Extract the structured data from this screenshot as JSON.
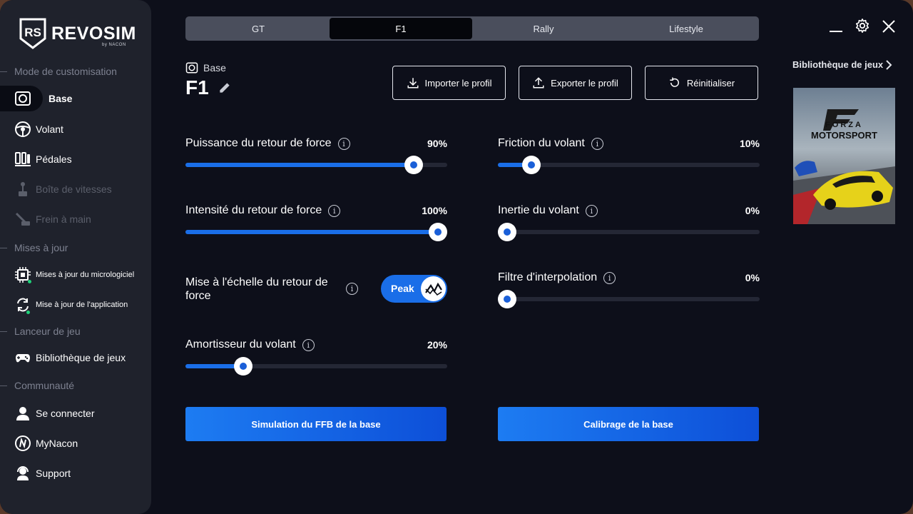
{
  "brand": {
    "name": "REVOSIM",
    "sub": "by NACON"
  },
  "sidebar": {
    "sections": {
      "customisation": "Mode de customisation",
      "updates": "Mises à jour",
      "launcher": "Lanceur de jeu",
      "community": "Communauté"
    },
    "items": {
      "base": "Base",
      "wheel": "Volant",
      "pedals": "Pédales",
      "gearbox": "Boîte de vitesses",
      "handbrake": "Frein à main",
      "firmware": "Mises à jour du micrologiciel",
      "app_update": "Mise à jour de l'application",
      "library": "Bibliothèque de jeux",
      "login": "Se connecter",
      "mynacon": "MyNacon",
      "support": "Support"
    }
  },
  "tabs": [
    "GT",
    "F1",
    "Rally",
    "Lifestyle"
  ],
  "active_tab": "F1",
  "header": {
    "device_label": "Base",
    "profile_name": "F1",
    "import_label": "Importer le profil",
    "export_label": "Exporter le profil",
    "reset_label": "Réinitialiser"
  },
  "settings": {
    "ffb_power": {
      "label": "Puissance du retour de force",
      "value_text": "90%",
      "value": 0.9
    },
    "ffb_intensity": {
      "label": "Intensité du retour de force",
      "value_text": "100%",
      "value": 1.0
    },
    "ffb_scaling": {
      "label": "Mise à l'échelle du retour de force",
      "toggle_text": "Peak",
      "enabled": true
    },
    "damper": {
      "label": "Amortisseur du volant",
      "value_text": "20%",
      "value": 0.2
    },
    "friction": {
      "label": "Friction du volant",
      "value_text": "10%",
      "value": 0.1
    },
    "inertia": {
      "label": "Inertie du volant",
      "value_text": "0%",
      "value": 0.0
    },
    "interpolation": {
      "label": "Filtre d'interpolation",
      "value_text": "0%",
      "value": 0.0
    }
  },
  "actions": {
    "simulate": "Simulation du FFB de la base",
    "calibrate": "Calibrage de la base"
  },
  "library_panel": {
    "link": "Bibliothèque de jeux",
    "game_title_line1": "FORZA",
    "game_title_line2": "MOTORSPORT"
  },
  "colors": {
    "accent": "#1a6ee8",
    "background": "#0d0f1a",
    "sidebar": "#1f222c",
    "status_dot": "#1fd37a"
  }
}
